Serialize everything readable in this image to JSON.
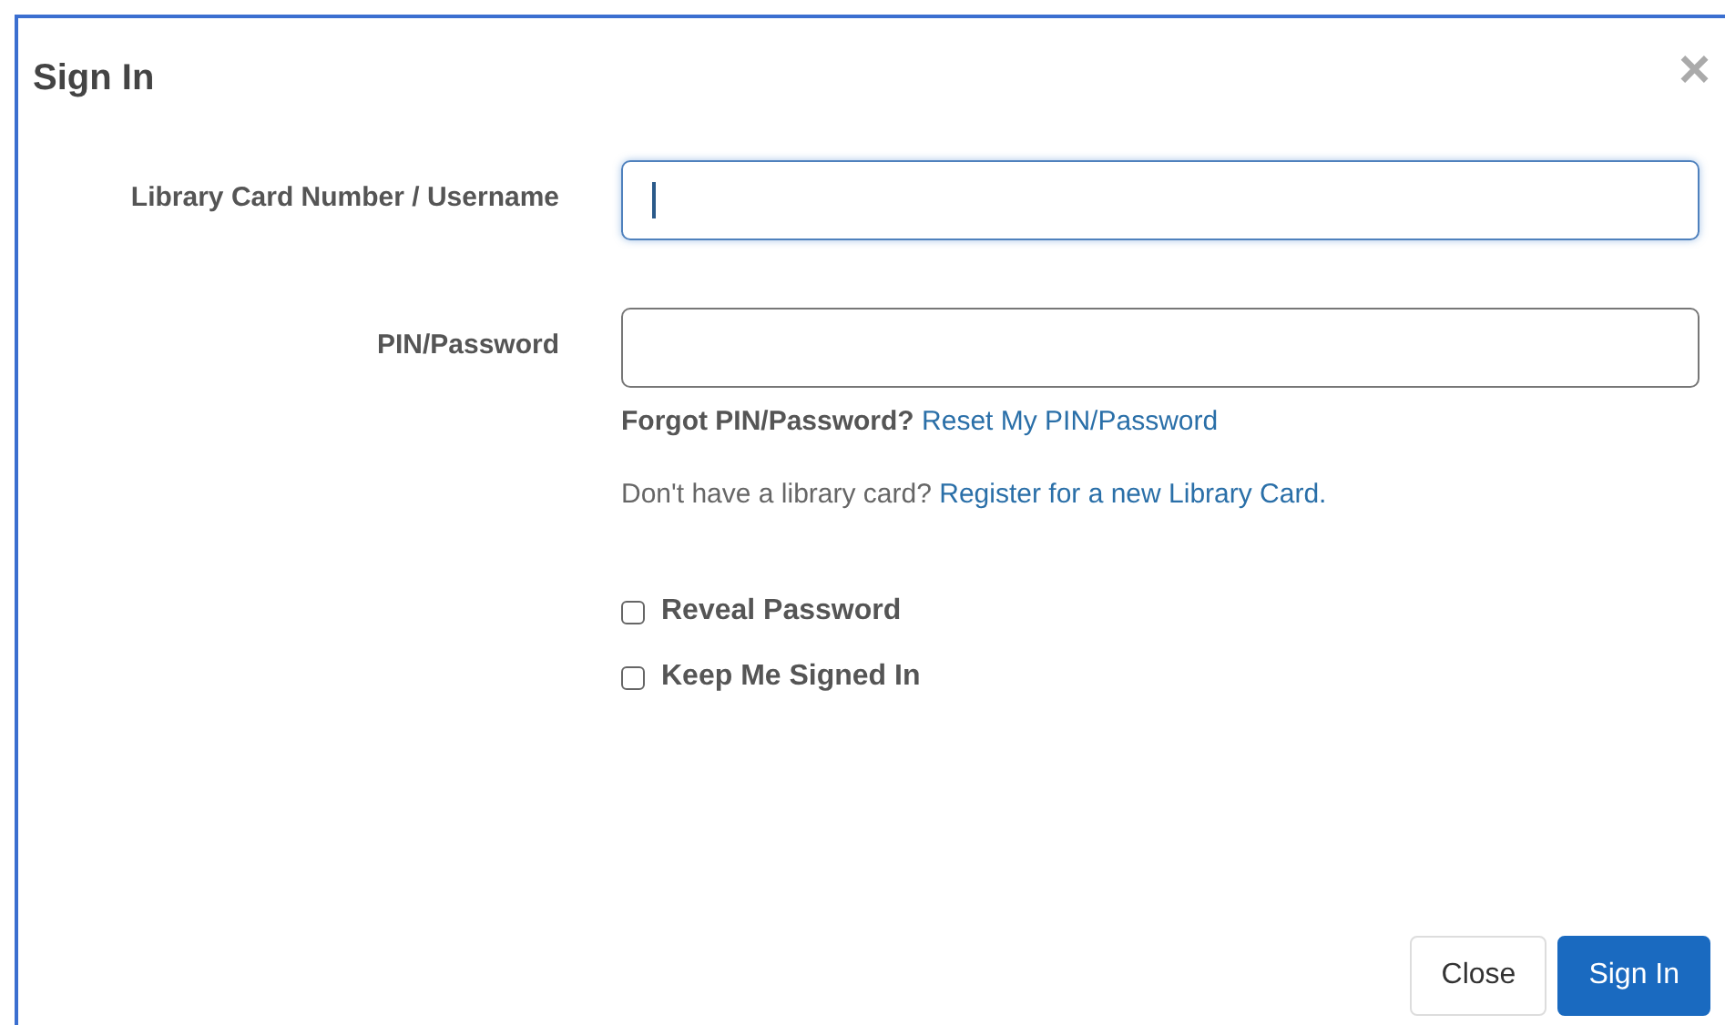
{
  "dialog": {
    "title": "Sign In",
    "close_glyph": "×"
  },
  "fields": [
    {
      "label": "Library Card Number / Username",
      "focused": true
    },
    {
      "label": "PIN/Password",
      "focused": false
    }
  ],
  "forgot": {
    "prompt": "Forgot PIN/Password?",
    "link": "Reset My PIN/Password"
  },
  "register": {
    "prompt": "Don't have a library card?",
    "link": "Register for a new Library Card."
  },
  "checkboxes": [
    {
      "label": "Reveal Password",
      "checked": false
    },
    {
      "label": "Keep Me Signed In",
      "checked": false
    }
  ],
  "buttons": [
    {
      "label": "Close",
      "kind": "secondary"
    },
    {
      "label": "Sign In",
      "kind": "primary"
    }
  ]
}
